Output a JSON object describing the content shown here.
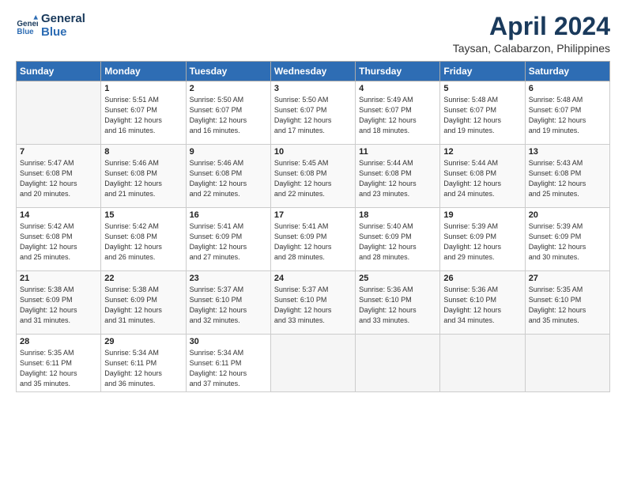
{
  "header": {
    "logo_line1": "General",
    "logo_line2": "Blue",
    "title": "April 2024",
    "location": "Taysan, Calabarzon, Philippines"
  },
  "weekdays": [
    "Sunday",
    "Monday",
    "Tuesday",
    "Wednesday",
    "Thursday",
    "Friday",
    "Saturday"
  ],
  "weeks": [
    [
      {
        "day": "",
        "info": ""
      },
      {
        "day": "1",
        "info": "Sunrise: 5:51 AM\nSunset: 6:07 PM\nDaylight: 12 hours\nand 16 minutes."
      },
      {
        "day": "2",
        "info": "Sunrise: 5:50 AM\nSunset: 6:07 PM\nDaylight: 12 hours\nand 16 minutes."
      },
      {
        "day": "3",
        "info": "Sunrise: 5:50 AM\nSunset: 6:07 PM\nDaylight: 12 hours\nand 17 minutes."
      },
      {
        "day": "4",
        "info": "Sunrise: 5:49 AM\nSunset: 6:07 PM\nDaylight: 12 hours\nand 18 minutes."
      },
      {
        "day": "5",
        "info": "Sunrise: 5:48 AM\nSunset: 6:07 PM\nDaylight: 12 hours\nand 19 minutes."
      },
      {
        "day": "6",
        "info": "Sunrise: 5:48 AM\nSunset: 6:07 PM\nDaylight: 12 hours\nand 19 minutes."
      }
    ],
    [
      {
        "day": "7",
        "info": "Sunrise: 5:47 AM\nSunset: 6:08 PM\nDaylight: 12 hours\nand 20 minutes."
      },
      {
        "day": "8",
        "info": "Sunrise: 5:46 AM\nSunset: 6:08 PM\nDaylight: 12 hours\nand 21 minutes."
      },
      {
        "day": "9",
        "info": "Sunrise: 5:46 AM\nSunset: 6:08 PM\nDaylight: 12 hours\nand 22 minutes."
      },
      {
        "day": "10",
        "info": "Sunrise: 5:45 AM\nSunset: 6:08 PM\nDaylight: 12 hours\nand 22 minutes."
      },
      {
        "day": "11",
        "info": "Sunrise: 5:44 AM\nSunset: 6:08 PM\nDaylight: 12 hours\nand 23 minutes."
      },
      {
        "day": "12",
        "info": "Sunrise: 5:44 AM\nSunset: 6:08 PM\nDaylight: 12 hours\nand 24 minutes."
      },
      {
        "day": "13",
        "info": "Sunrise: 5:43 AM\nSunset: 6:08 PM\nDaylight: 12 hours\nand 25 minutes."
      }
    ],
    [
      {
        "day": "14",
        "info": "Sunrise: 5:42 AM\nSunset: 6:08 PM\nDaylight: 12 hours\nand 25 minutes."
      },
      {
        "day": "15",
        "info": "Sunrise: 5:42 AM\nSunset: 6:08 PM\nDaylight: 12 hours\nand 26 minutes."
      },
      {
        "day": "16",
        "info": "Sunrise: 5:41 AM\nSunset: 6:09 PM\nDaylight: 12 hours\nand 27 minutes."
      },
      {
        "day": "17",
        "info": "Sunrise: 5:41 AM\nSunset: 6:09 PM\nDaylight: 12 hours\nand 28 minutes."
      },
      {
        "day": "18",
        "info": "Sunrise: 5:40 AM\nSunset: 6:09 PM\nDaylight: 12 hours\nand 28 minutes."
      },
      {
        "day": "19",
        "info": "Sunrise: 5:39 AM\nSunset: 6:09 PM\nDaylight: 12 hours\nand 29 minutes."
      },
      {
        "day": "20",
        "info": "Sunrise: 5:39 AM\nSunset: 6:09 PM\nDaylight: 12 hours\nand 30 minutes."
      }
    ],
    [
      {
        "day": "21",
        "info": "Sunrise: 5:38 AM\nSunset: 6:09 PM\nDaylight: 12 hours\nand 31 minutes."
      },
      {
        "day": "22",
        "info": "Sunrise: 5:38 AM\nSunset: 6:09 PM\nDaylight: 12 hours\nand 31 minutes."
      },
      {
        "day": "23",
        "info": "Sunrise: 5:37 AM\nSunset: 6:10 PM\nDaylight: 12 hours\nand 32 minutes."
      },
      {
        "day": "24",
        "info": "Sunrise: 5:37 AM\nSunset: 6:10 PM\nDaylight: 12 hours\nand 33 minutes."
      },
      {
        "day": "25",
        "info": "Sunrise: 5:36 AM\nSunset: 6:10 PM\nDaylight: 12 hours\nand 33 minutes."
      },
      {
        "day": "26",
        "info": "Sunrise: 5:36 AM\nSunset: 6:10 PM\nDaylight: 12 hours\nand 34 minutes."
      },
      {
        "day": "27",
        "info": "Sunrise: 5:35 AM\nSunset: 6:10 PM\nDaylight: 12 hours\nand 35 minutes."
      }
    ],
    [
      {
        "day": "28",
        "info": "Sunrise: 5:35 AM\nSunset: 6:11 PM\nDaylight: 12 hours\nand 35 minutes."
      },
      {
        "day": "29",
        "info": "Sunrise: 5:34 AM\nSunset: 6:11 PM\nDaylight: 12 hours\nand 36 minutes."
      },
      {
        "day": "30",
        "info": "Sunrise: 5:34 AM\nSunset: 6:11 PM\nDaylight: 12 hours\nand 37 minutes."
      },
      {
        "day": "",
        "info": ""
      },
      {
        "day": "",
        "info": ""
      },
      {
        "day": "",
        "info": ""
      },
      {
        "day": "",
        "info": ""
      }
    ]
  ]
}
